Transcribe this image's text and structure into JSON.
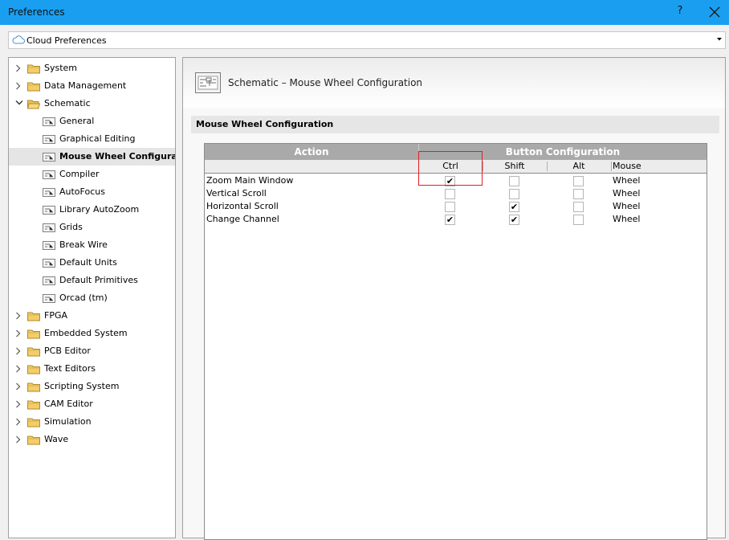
{
  "window": {
    "title": "Preferences",
    "help_glyph": "?",
    "close_glyph": "✕"
  },
  "cloud": {
    "label": "Cloud Preferences",
    "icon": "cloud-icon"
  },
  "tree": {
    "items": [
      {
        "label": "System",
        "level": 0,
        "expanded": false,
        "icon": "folder-icon"
      },
      {
        "label": "Data Management",
        "level": 0,
        "expanded": false,
        "icon": "folder-icon"
      },
      {
        "label": "Schematic",
        "level": 0,
        "expanded": true,
        "icon": "folder-open-icon"
      },
      {
        "label": "General",
        "level": 1,
        "icon": "page-icon"
      },
      {
        "label": "Graphical Editing",
        "level": 1,
        "icon": "page-icon"
      },
      {
        "label": "Mouse Wheel Configuration",
        "level": 1,
        "selected": true,
        "icon": "page-icon"
      },
      {
        "label": "Compiler",
        "level": 1,
        "icon": "page-icon"
      },
      {
        "label": "AutoFocus",
        "level": 1,
        "icon": "page-icon"
      },
      {
        "label": "Library AutoZoom",
        "level": 1,
        "icon": "page-icon"
      },
      {
        "label": "Grids",
        "level": 1,
        "icon": "page-icon"
      },
      {
        "label": "Break Wire",
        "level": 1,
        "icon": "page-icon"
      },
      {
        "label": "Default Units",
        "level": 1,
        "icon": "page-icon"
      },
      {
        "label": "Default Primitives",
        "level": 1,
        "icon": "page-icon"
      },
      {
        "label": "Orcad (tm)",
        "level": 1,
        "icon": "page-icon"
      },
      {
        "label": "FPGA",
        "level": 0,
        "expanded": false,
        "icon": "folder-icon"
      },
      {
        "label": "Embedded System",
        "level": 0,
        "expanded": false,
        "icon": "folder-icon"
      },
      {
        "label": "PCB Editor",
        "level": 0,
        "expanded": false,
        "icon": "folder-icon"
      },
      {
        "label": "Text Editors",
        "level": 0,
        "expanded": false,
        "icon": "folder-icon"
      },
      {
        "label": "Scripting System",
        "level": 0,
        "expanded": false,
        "icon": "folder-icon"
      },
      {
        "label": "CAM Editor",
        "level": 0,
        "expanded": false,
        "icon": "folder-icon"
      },
      {
        "label": "Simulation",
        "level": 0,
        "expanded": false,
        "icon": "folder-icon"
      },
      {
        "label": "Wave",
        "level": 0,
        "expanded": false,
        "icon": "folder-icon"
      }
    ]
  },
  "panel": {
    "title": "Schematic – Mouse Wheel Configuration",
    "section": "Mouse Wheel Configuration",
    "grid": {
      "header_action": "Action",
      "header_button": "Button Configuration",
      "sub_headers": [
        "Ctrl",
        "Shift",
        "Alt",
        "Mouse"
      ],
      "rows": [
        {
          "action": "Zoom Main Window",
          "ctrl": true,
          "shift": false,
          "alt": false,
          "mouse": "Wheel"
        },
        {
          "action": "Vertical Scroll",
          "ctrl": false,
          "shift": false,
          "alt": false,
          "mouse": "Wheel"
        },
        {
          "action": "Horizontal Scroll",
          "ctrl": false,
          "shift": true,
          "alt": false,
          "mouse": "Wheel"
        },
        {
          "action": "Change Channel",
          "ctrl": true,
          "shift": true,
          "alt": false,
          "mouse": "Wheel"
        }
      ]
    }
  },
  "colors": {
    "titlebar": "#1a9ff0",
    "highlight": "#e02020",
    "grid_header": "#a9a9a9"
  }
}
